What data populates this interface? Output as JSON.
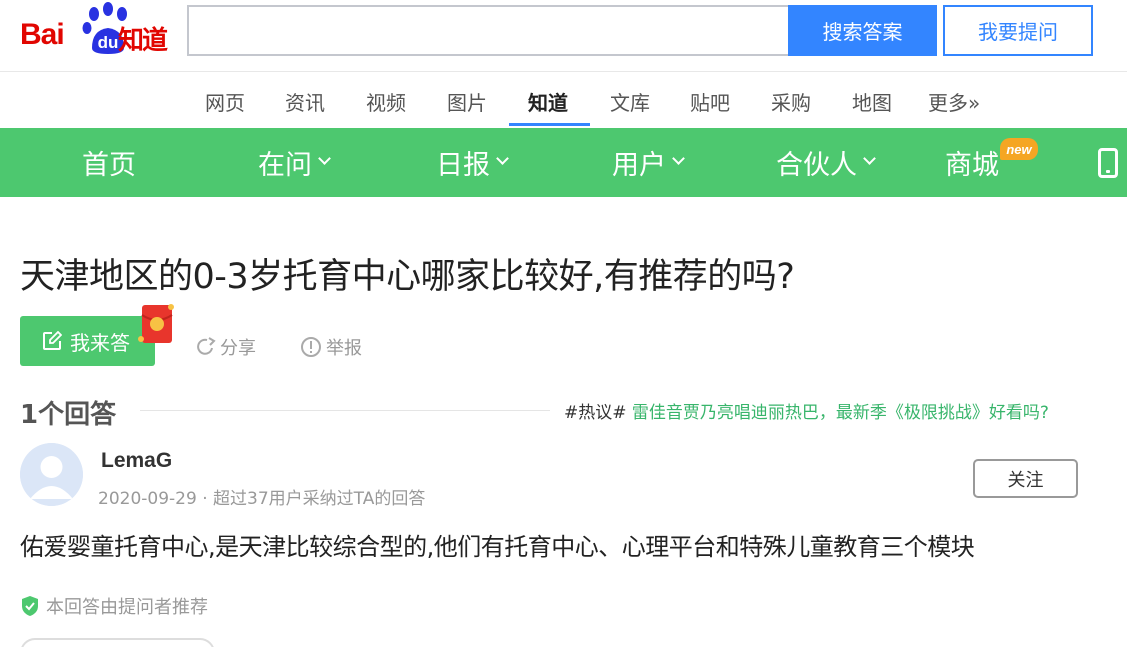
{
  "header": {
    "logo_bai": "Bai",
    "logo_du": "du",
    "logo_zhidao": "知道",
    "search_value": "",
    "search_button": "搜索答案",
    "ask_button": "我要提问"
  },
  "channels": [
    "网页",
    "资讯",
    "视频",
    "图片",
    "知道",
    "文库",
    "贴吧",
    "采购",
    "地图",
    "更多»"
  ],
  "active_channel": "知道",
  "green_nav": {
    "items": [
      "首页",
      "在问",
      "日报",
      "用户",
      "合伙人",
      "商城"
    ],
    "badge": "new"
  },
  "question": {
    "title": "天津地区的0-3岁托育中心哪家比较好,有推荐的吗?",
    "answer_button": "我来答",
    "share": "分享",
    "report": "举报"
  },
  "answers_section": {
    "count_label": "1个回答",
    "hot_tag": "#热议#",
    "hot_text": "雷佳音贾乃亮唱迪丽热巴，最新季《极限挑战》好看吗?"
  },
  "answer": {
    "username": "LemaG",
    "meta": "2020-09-29 · 超过37用户采纳过TA的回答",
    "follow_button": "关注",
    "text": "佑爱婴童托育中心,是天津比较综合型的,他们有托育中心、心理平台和特殊儿童教育三个模块",
    "recommend": "本回答由提问者推荐"
  },
  "colors": {
    "brand_red": "#e10601",
    "baidu_blue": "#3385ff",
    "green": "#4dc86f",
    "hot_green": "#38b56b"
  }
}
